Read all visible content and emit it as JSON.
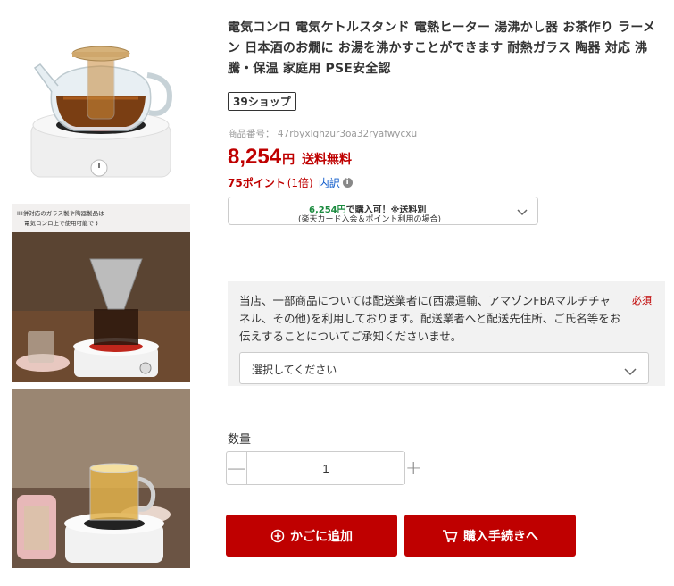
{
  "product": {
    "title": "電気コンロ 電気ケトルスタンド 電熱ヒーター 湯沸かし器 お茶作り ラーメン 日本酒のお燗に お湯を沸かすことができます 耐熱ガラス 陶器 対応 沸騰・保温 家庭用 PSE安全認",
    "shop_badge": "39ショップ",
    "item_number": "商品番号： 47rbyxlghzur3oa32ryafwycxu",
    "price": "8,254",
    "currency": "円",
    "shipping": "送料無料",
    "points": "75ポイント",
    "points_rate": "(1倍)",
    "breakdown": "内訳",
    "info_icon": "i"
  },
  "card_offer": {
    "price": "6,254円",
    "line1_rest": "で購入可！※送料別",
    "line2": "(楽天カード入会＆ポイント利用の場合)"
  },
  "image_caption": "IH併対応のガラス製や陶器製品は 電気コンロ上で使用可能です",
  "notice": {
    "text": "当店、一部商品については配送業者に(西濃運輸、アマゾンFBAマルチチャネル、その他)を利用しております。配送業者へと配送先住所、ご氏名等をお伝えすることについてご承知くださいませ。",
    "required": "必須",
    "select_label": "選択してください"
  },
  "quantity": {
    "label": "数量",
    "value": "1",
    "minus": "—",
    "plus": "+"
  },
  "buttons": {
    "add_to_cart": "かごに追加",
    "checkout": "購入手続きへ"
  },
  "colors": {
    "accent": "#bf0000",
    "card_price": "#1a8a3e",
    "link": "#0a58ca"
  }
}
